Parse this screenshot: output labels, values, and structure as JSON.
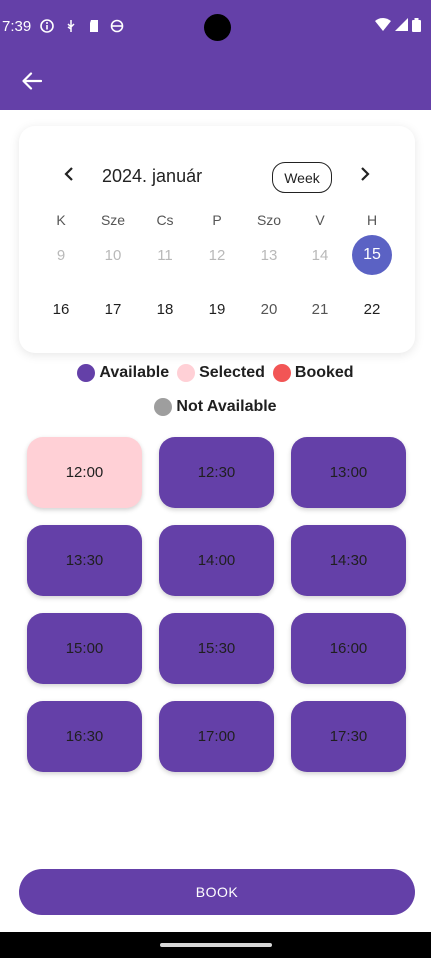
{
  "status_bar": {
    "time": "7:39"
  },
  "calendar": {
    "month_label": "2024. január",
    "view_button": "Week",
    "weekdays": [
      "K",
      "Sze",
      "Cs",
      "P",
      "Szo",
      "V",
      "H"
    ],
    "week1": [
      "9",
      "10",
      "11",
      "12",
      "13",
      "14",
      "15"
    ],
    "week2": [
      "16",
      "17",
      "18",
      "19",
      "20",
      "21",
      "22"
    ],
    "selected_day": "15"
  },
  "legend": {
    "available": "Available",
    "selected": "Selected",
    "booked": "Booked",
    "not_available": "Not Available"
  },
  "colors": {
    "primary": "#6440a8",
    "available": "#6440a8",
    "selected": "#ffd0d6",
    "booked": "#f25555",
    "not_available": "#9e9e9e",
    "selected_day": "#5b62c4"
  },
  "slots": [
    {
      "time": "12:00",
      "state": "selected"
    },
    {
      "time": "12:30",
      "state": "available"
    },
    {
      "time": "13:00",
      "state": "available"
    },
    {
      "time": "13:30",
      "state": "available"
    },
    {
      "time": "14:00",
      "state": "available"
    },
    {
      "time": "14:30",
      "state": "available"
    },
    {
      "time": "15:00",
      "state": "available"
    },
    {
      "time": "15:30",
      "state": "available"
    },
    {
      "time": "16:00",
      "state": "available"
    },
    {
      "time": "16:30",
      "state": "available"
    },
    {
      "time": "17:00",
      "state": "available"
    },
    {
      "time": "17:30",
      "state": "available"
    }
  ],
  "book_button": "BOOK"
}
